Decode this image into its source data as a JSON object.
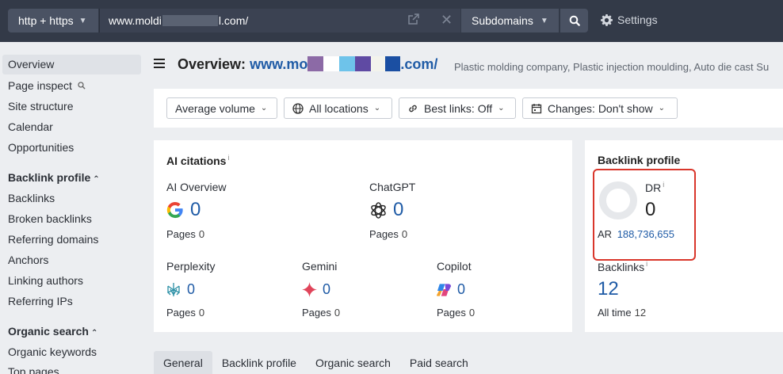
{
  "topbar": {
    "protocol": "http + https",
    "url_prefix": "www.moldi",
    "url_suffix": "l.com/",
    "subdomains": "Subdomains",
    "settings": "Settings"
  },
  "sidebar": {
    "items_top": [
      "Overview",
      "Page inspect",
      "Site structure",
      "Calendar",
      "Opportunities"
    ],
    "backlink_header": "Backlink profile",
    "backlink_items": [
      "Backlinks",
      "Broken backlinks",
      "Referring domains",
      "Anchors",
      "Linking authors",
      "Referring IPs"
    ],
    "organic_header": "Organic search",
    "organic_items": [
      "Organic keywords",
      "Top pages"
    ]
  },
  "header": {
    "title_prefix": "Overview:",
    "domain_start": "www.mo",
    "domain_end": ".com/",
    "description": "Plastic molding company, Plastic injection moulding, Auto die cast Su"
  },
  "filters": {
    "volume": "Average volume",
    "locations": "All locations",
    "best_links": "Best links: Off",
    "changes": "Changes: Don't show"
  },
  "ai_citations": {
    "title": "AI citations",
    "info": "i",
    "pages_label": "Pages",
    "ai_overview": {
      "label": "AI Overview",
      "value": "0",
      "pages": "0"
    },
    "chatgpt": {
      "label": "ChatGPT",
      "value": "0",
      "pages": "0"
    },
    "perplexity": {
      "label": "Perplexity",
      "value": "0",
      "pages": "0"
    },
    "gemini": {
      "label": "Gemini",
      "value": "0",
      "pages": "0"
    },
    "copilot": {
      "label": "Copilot",
      "value": "0",
      "pages": "0"
    }
  },
  "backlink_profile": {
    "title": "Backlink profile",
    "dr_label": "DR",
    "dr_info": "i",
    "dr_value": "0",
    "ar_label": "AR",
    "ar_value": "188,736,655",
    "backlinks_label": "Backlinks",
    "backlinks_info": "i",
    "backlinks_value": "12",
    "all_time_label": "All time",
    "all_time_value": "12"
  },
  "tabs": [
    "General",
    "Backlink profile",
    "Organic search",
    "Paid search"
  ],
  "colors": {
    "topbar_bg": "#333a48",
    "link_blue": "#1f5ba6",
    "highlight_red": "#d9362b",
    "mask_blocks": [
      "#8c6aa6",
      "#6ec3ea",
      "#5f4aa3",
      "#f3f3ec",
      "#1b4fa2"
    ]
  },
  "icons": {
    "search": "search-icon",
    "settings": "gear-icon",
    "globe": "globe-icon",
    "link": "link-icon",
    "calendar": "calendar-icon"
  }
}
